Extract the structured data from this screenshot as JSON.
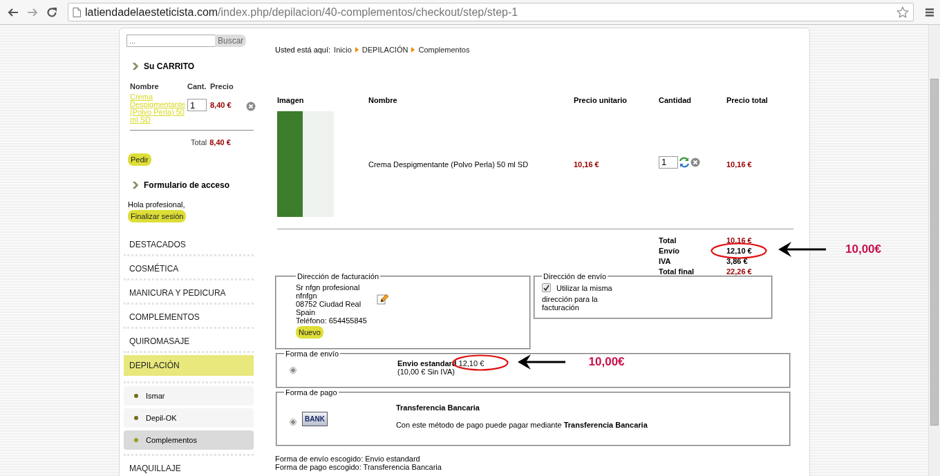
{
  "browser": {
    "url_host": "latiendadelaesteticista.com",
    "url_path": "/index.php/depilacion/40-complementos/checkout/step/step-1"
  },
  "sidebar": {
    "search": {
      "placeholder": "...",
      "button": "Buscar"
    },
    "cart": {
      "title": "Su CARRITO",
      "columns": [
        "Nombre",
        "Cant.",
        "Precio"
      ],
      "items": [
        {
          "name": "Crema Despigmentante (Polvo Perla) 50 ml SD",
          "quantity": "1",
          "price": "8,40 €"
        }
      ],
      "total_label": "Total",
      "total_value": "8,40 €",
      "order_button": "Pedir"
    },
    "login": {
      "title": "Formulario de acceso",
      "greeting": "Hola profesional,",
      "logout_button": "Finalizar sesión"
    },
    "menu": [
      {
        "label": "DESTACADOS",
        "selected": false
      },
      {
        "label": "COSMÉTICA",
        "selected": false
      },
      {
        "label": "MANICURA Y PEDICURA",
        "selected": false
      },
      {
        "label": "COMPLEMENTOS",
        "selected": false
      },
      {
        "label": "QUIROMASAJE",
        "selected": false
      },
      {
        "label": "DEPILACIÓN",
        "selected": true,
        "children": [
          {
            "label": "Ismar",
            "selected": false
          },
          {
            "label": "Depil-OK",
            "selected": false
          },
          {
            "label": "Complementos",
            "selected": true
          }
        ]
      },
      {
        "label": "MAQUILLAJE",
        "selected": false
      }
    ]
  },
  "main": {
    "breadcrumb": {
      "prefix": "Usted está aquí:",
      "items": [
        "Inicio",
        "DEPILACIÓN",
        "Complementos"
      ]
    },
    "table": {
      "columns": [
        "Imagen",
        "Nombre",
        "Precio unitario",
        "Cantidad",
        "Precio total"
      ],
      "rows": [
        {
          "name": "Crema Despigmentante (Polvo Perla) 50 ml SD",
          "unit_price": "10,16 €",
          "quantity": "1",
          "total": "10,16 €"
        }
      ]
    },
    "totals": [
      {
        "label": "Total",
        "value": "10,16 €",
        "color": "#990000"
      },
      {
        "label": "Envío",
        "value": "12,10 €",
        "color": "#000000",
        "annotation": "10,00€"
      },
      {
        "label": "IVA",
        "value": "3,86 €",
        "color": "#000000"
      },
      {
        "label": "Total final",
        "value": "22,26 €",
        "color": "#990000"
      }
    ],
    "billing_address": {
      "legend": "Dirección de facturación",
      "lines": [
        "Sr nfgn profesional",
        "nfnfgn",
        "08752 Ciudad Real",
        "Spain",
        "Teléfono: 654455845"
      ],
      "new_button": "Nuevo"
    },
    "shipping_address": {
      "legend": "Dirección de envío",
      "same_checked": true,
      "checkbox_label": "Utilizar la misma",
      "note": "dirección para la facturación"
    },
    "shipping_method": {
      "legend": "Forma de envío",
      "options": [
        {
          "selected": true,
          "name": "Envio estandard",
          "price": "12,10 €",
          "note": "(10,00 € Sin IVA)",
          "annotation": "10,00€"
        }
      ]
    },
    "payment_method": {
      "legend": "Forma de pago",
      "options": [
        {
          "selected": true,
          "logo": "BANK",
          "name": "Transferencia Bancaria",
          "description": "Con este método de pago puede pagar mediante **Transferencia Bancaria**"
        }
      ]
    },
    "summary": [
      "Forma de envío escogido: Envio estandard",
      "Forma de pago escogido: Transferencia Bancaria"
    ]
  }
}
